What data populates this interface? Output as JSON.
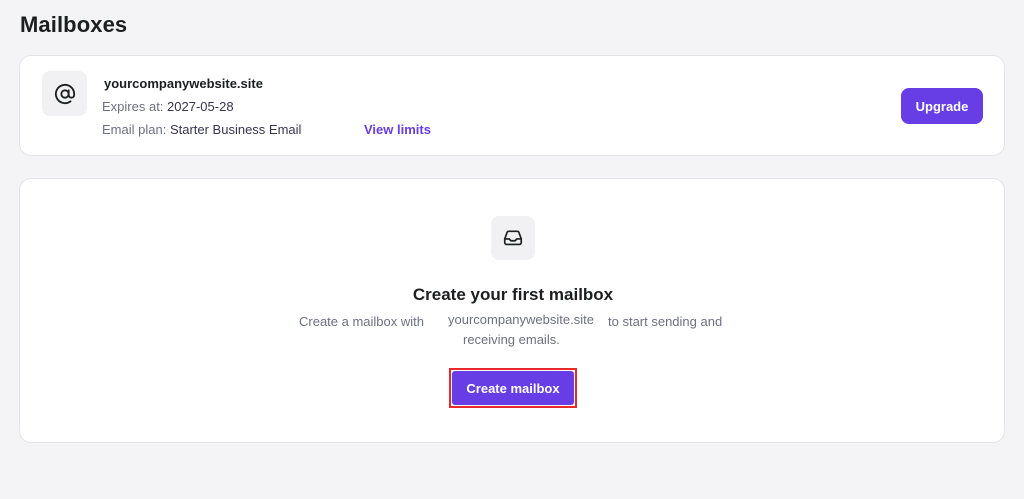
{
  "page": {
    "title": "Mailboxes"
  },
  "domain_card": {
    "icon": "at-sign-icon",
    "domain": "yourcompanywebsite.site",
    "expires_label": "Expires at:",
    "expires_value": "2027-05-28",
    "plan_label": "Email plan:",
    "plan_value": "Starter Business Email",
    "view_limits": "View limits",
    "upgrade": "Upgrade"
  },
  "empty_state": {
    "icon": "inbox-icon",
    "title": "Create your first mailbox",
    "desc_prefix": "Create a mailbox with",
    "desc_domain": "yourcompanywebsite.site",
    "desc_suffix": "to start sending and",
    "desc_line2": "receiving emails.",
    "button": "Create mailbox"
  },
  "colors": {
    "accent": "#673de6",
    "highlight_border": "#e8282d",
    "background": "#f4f4f6"
  }
}
